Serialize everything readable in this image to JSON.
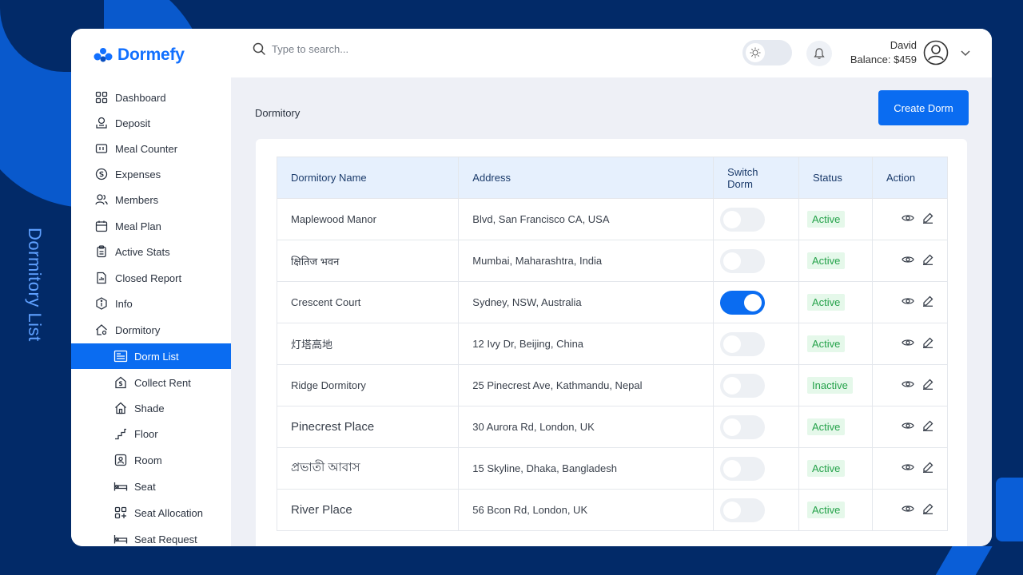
{
  "caption": "Dormitory List",
  "app": {
    "name": "Dormefy"
  },
  "search": {
    "placeholder": "Type to search..."
  },
  "user": {
    "name": "David",
    "balance": "Balance: $459"
  },
  "sidebar": {
    "items": [
      {
        "label": "Dashboard",
        "icon": "grid-icon"
      },
      {
        "label": "Deposit",
        "icon": "deposit-icon"
      },
      {
        "label": "Meal Counter",
        "icon": "counter-icon"
      },
      {
        "label": "Expenses",
        "icon": "expenses-icon"
      },
      {
        "label": "Members",
        "icon": "members-icon"
      },
      {
        "label": "Meal Plan",
        "icon": "calendar-icon"
      },
      {
        "label": "Active Stats",
        "icon": "clipboard-icon"
      },
      {
        "label": "Closed Report",
        "icon": "report-icon"
      },
      {
        "label": "Info",
        "icon": "info-icon"
      },
      {
        "label": "Dormitory",
        "icon": "home-gear-icon"
      }
    ],
    "subitems": [
      {
        "label": "Dorm List",
        "icon": "bed-list-icon",
        "active": true
      },
      {
        "label": "Collect Rent",
        "icon": "rent-icon"
      },
      {
        "label": "Shade",
        "icon": "house-icon"
      },
      {
        "label": "Floor",
        "icon": "stairs-icon"
      },
      {
        "label": "Room",
        "icon": "room-icon"
      },
      {
        "label": "Seat",
        "icon": "bed-icon"
      },
      {
        "label": "Seat Allocation",
        "icon": "allocation-icon"
      },
      {
        "label": "Seat Request",
        "icon": "bed-icon"
      }
    ]
  },
  "main": {
    "title": "Dormitory",
    "create_label": "Create Dorm",
    "columns": [
      "Dormitory Name",
      "Address",
      "Switch Dorm",
      "Status",
      "Action"
    ],
    "rows": [
      {
        "name": "Maplewood Manor",
        "address": "Blvd, San Francisco CA, USA",
        "switch": false,
        "status": "Active"
      },
      {
        "name": "क्षितिज भवन",
        "address": "Mumbai, Maharashtra, India",
        "switch": false,
        "status": "Active"
      },
      {
        "name": "Crescent Court",
        "address": "Sydney, NSW, Australia",
        "switch": true,
        "status": "Active"
      },
      {
        "name": "灯塔高地",
        "address": "12 Ivy Dr, Beijing, China",
        "switch": false,
        "status": "Active"
      },
      {
        "name": "Ridge Dormitory",
        "address": "25 Pinecrest Ave, Kathmandu, Nepal",
        "switch": false,
        "status": "Inactive"
      },
      {
        "name": "Pinecrest Place",
        "address": "30 Aurora Rd, London, UK",
        "switch": false,
        "status": "Active"
      },
      {
        "name": "প্রভাতী আবাস",
        "address": "15 Skyline, Dhaka, Bangladesh",
        "switch": false,
        "status": "Active"
      },
      {
        "name": "River Place",
        "address": "56 Bcon Rd, London, UK",
        "switch": false,
        "status": "Active"
      }
    ]
  },
  "colors": {
    "brand": "#1270ff",
    "accent": "#0a6cf1",
    "active_bg": "#e5f8ea",
    "active_text": "#25a24a",
    "header_bg": "#e6f0fd"
  }
}
